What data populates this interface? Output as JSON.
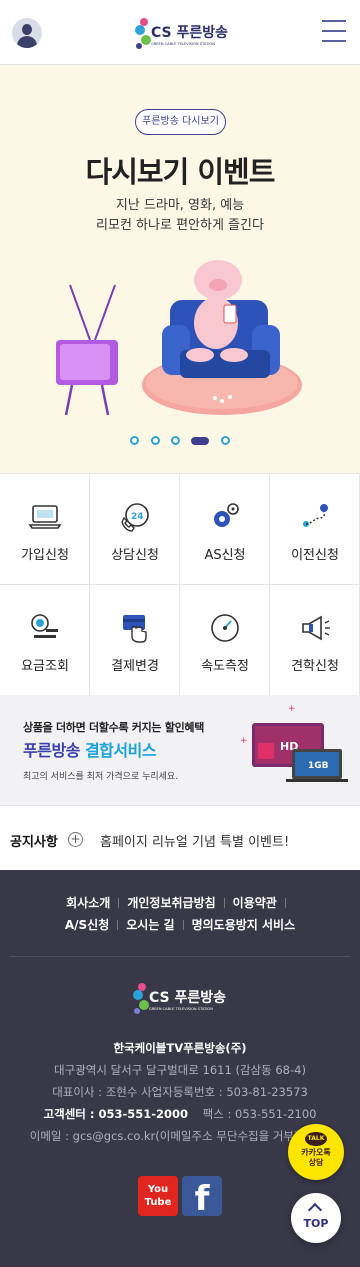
{
  "header": {
    "logo_mark": "gcs",
    "logo_brand": "CS 푸른방송",
    "logo_sub": "GREEN CABLE TELEVISION STATION"
  },
  "hero": {
    "tag": "푸른방송 다시보기",
    "title": "다시보기 이벤트",
    "subtitle_line1": "지난 드라마, 영화, 예능",
    "subtitle_line2": "리모컨 하나로 편안하게 즐긴다",
    "slides_total": 5,
    "active_slide": 4
  },
  "quick_menu": [
    {
      "label": "가입신청",
      "icon": "laptop-icon"
    },
    {
      "label": "상담신청",
      "icon": "phone-24-icon"
    },
    {
      "label": "AS신청",
      "icon": "gear-icon"
    },
    {
      "label": "이전신청",
      "icon": "route-icon"
    },
    {
      "label": "요금조회",
      "icon": "coin-icon"
    },
    {
      "label": "결제변경",
      "icon": "card-icon"
    },
    {
      "label": "속도측정",
      "icon": "speedometer-icon"
    },
    {
      "label": "견학신청",
      "icon": "megaphone-icon"
    }
  ],
  "bundle": {
    "line1": "상품을 더하면 더할수록 커지는 할인혜택",
    "line2_a": "푸른방송 ",
    "line2_b": "결합서비스",
    "line3": "최고의 서비스를 최저 가격으로 누리세요.",
    "tv_label": "HD",
    "laptop_label": "1GB"
  },
  "notice": {
    "title": "공지사항",
    "plus": "+",
    "text": "홈페이지 리뉴얼 기념 특별 이벤트!"
  },
  "footer": {
    "links_row1": [
      "회사소개",
      "개인정보취급방침",
      "이용약관"
    ],
    "links_row2": [
      "A/S신청",
      "오시는 길",
      "명의도용방지 서비스"
    ],
    "company": "한국케이블TV푸른방송(주)",
    "address": "대구광역시 달서구 달구벌대로 1611 (감삼동 68-4)",
    "ceo": "대표이사 : 조현수     사업자등록번호 : 503-81-23573",
    "cs_label": "고객센터 : 053-551-2000",
    "fax_label": "팩스 : 053-551-2100",
    "email": "이메일 : gcs@gcs.co.kr(이메일주소 무단수집을 거부합니다)",
    "youtube_line1": "You",
    "youtube_line2": "Tube",
    "facebook": "f"
  },
  "floating": {
    "kakao_bubble": "TALK",
    "kakao_line1": "카카오톡",
    "kakao_line2": "상담",
    "top": "TOP"
  },
  "colors": {
    "brand_navy": "#3e3f8f",
    "brand_sky": "#2ba3d7",
    "hero_bg": "#fdf8e6",
    "footer_bg": "#383848",
    "kakao_yellow": "#fde500"
  }
}
